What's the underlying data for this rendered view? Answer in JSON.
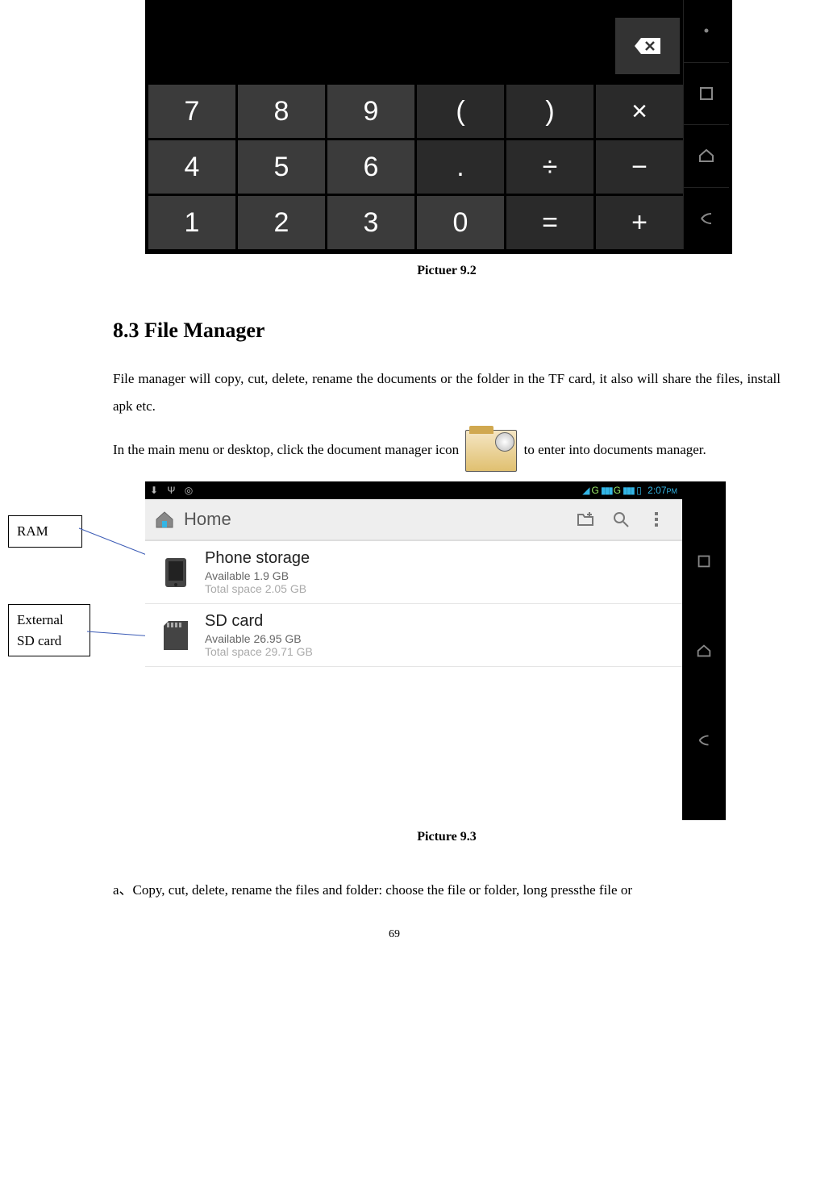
{
  "calc": {
    "keys": [
      {
        "label": "7",
        "cls": "num"
      },
      {
        "label": "8",
        "cls": "num"
      },
      {
        "label": "9",
        "cls": "num"
      },
      {
        "label": "(",
        "cls": "op"
      },
      {
        "label": ")",
        "cls": "op"
      },
      {
        "label": "×",
        "cls": "op"
      },
      {
        "label": "4",
        "cls": "num"
      },
      {
        "label": "5",
        "cls": "num"
      },
      {
        "label": "6",
        "cls": "num"
      },
      {
        "label": ".",
        "cls": "op"
      },
      {
        "label": "÷",
        "cls": "op"
      },
      {
        "label": "−",
        "cls": "op"
      },
      {
        "label": "1",
        "cls": "num"
      },
      {
        "label": "2",
        "cls": "num"
      },
      {
        "label": "3",
        "cls": "num"
      },
      {
        "label": "0",
        "cls": "num"
      },
      {
        "label": "=",
        "cls": "op"
      },
      {
        "label": "+",
        "cls": "op"
      }
    ]
  },
  "caption1": "Pictuer 9.2",
  "section_title": "8.3 File Manager",
  "p1": "File manager will copy, cut, delete, rename the documents or the folder in the TF card, it also will share the files, install apk etc.",
  "p2a": "In the main menu or desktop, click the document manager icon ",
  "p2b": " to enter into documents manager.",
  "annot1": "RAM",
  "annot2a": "External",
  "annot2b": "SD card",
  "fm": {
    "status_time": "2:07",
    "status_pm": "PM",
    "status_g": "G",
    "home_label": "Home",
    "items": [
      {
        "title": "Phone storage",
        "sub1": "Available 1.9 GB",
        "sub2": "Total space 2.05 GB"
      },
      {
        "title": "SD card",
        "sub1": "Available 26.95 GB",
        "sub2": "Total space 29.71 GB"
      }
    ]
  },
  "caption2": "Picture 9.3",
  "p3": "a、Copy, cut, delete, rename the files and folder: choose the file or folder, long pressthe file or",
  "pagenum": "69"
}
